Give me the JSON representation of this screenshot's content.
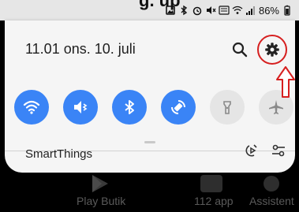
{
  "title_fragment": "g. up",
  "status": {
    "battery": "86%"
  },
  "panel": {
    "datetime": "11.01  ons. 10. juli",
    "toggles": [
      {
        "name": "wifi-toggle",
        "state": "on"
      },
      {
        "name": "sound-mode-toggle",
        "state": "on"
      },
      {
        "name": "bluetooth-toggle",
        "state": "on"
      },
      {
        "name": "auto-rotate-toggle",
        "state": "on"
      },
      {
        "name": "flashlight-toggle",
        "state": "off"
      },
      {
        "name": "airplane-mode-toggle",
        "state": "off"
      }
    ],
    "footer_label": "SmartThings"
  },
  "dock": {
    "labels": [
      "Play Butik",
      "112 app",
      "Assistent"
    ]
  },
  "colors": {
    "accent_blue": "#3a84f6",
    "highlight_red": "#d61f1f"
  }
}
